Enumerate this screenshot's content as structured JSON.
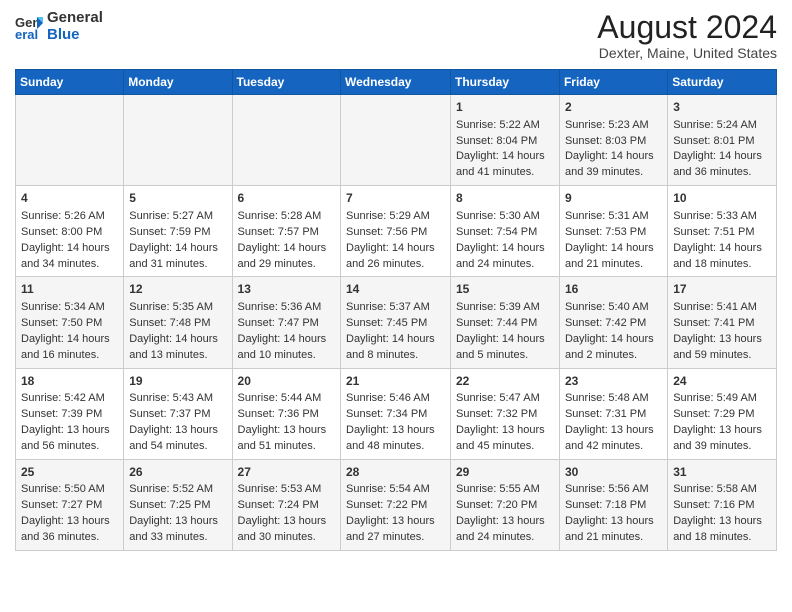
{
  "header": {
    "logo_general": "General",
    "logo_blue": "Blue",
    "month_year": "August 2024",
    "location": "Dexter, Maine, United States"
  },
  "days_of_week": [
    "Sunday",
    "Monday",
    "Tuesday",
    "Wednesday",
    "Thursday",
    "Friday",
    "Saturday"
  ],
  "weeks": [
    [
      {
        "day": "",
        "content": ""
      },
      {
        "day": "",
        "content": ""
      },
      {
        "day": "",
        "content": ""
      },
      {
        "day": "",
        "content": ""
      },
      {
        "day": "1",
        "content": "Sunrise: 5:22 AM\nSunset: 8:04 PM\nDaylight: 14 hours\nand 41 minutes."
      },
      {
        "day": "2",
        "content": "Sunrise: 5:23 AM\nSunset: 8:03 PM\nDaylight: 14 hours\nand 39 minutes."
      },
      {
        "day": "3",
        "content": "Sunrise: 5:24 AM\nSunset: 8:01 PM\nDaylight: 14 hours\nand 36 minutes."
      }
    ],
    [
      {
        "day": "4",
        "content": "Sunrise: 5:26 AM\nSunset: 8:00 PM\nDaylight: 14 hours\nand 34 minutes."
      },
      {
        "day": "5",
        "content": "Sunrise: 5:27 AM\nSunset: 7:59 PM\nDaylight: 14 hours\nand 31 minutes."
      },
      {
        "day": "6",
        "content": "Sunrise: 5:28 AM\nSunset: 7:57 PM\nDaylight: 14 hours\nand 29 minutes."
      },
      {
        "day": "7",
        "content": "Sunrise: 5:29 AM\nSunset: 7:56 PM\nDaylight: 14 hours\nand 26 minutes."
      },
      {
        "day": "8",
        "content": "Sunrise: 5:30 AM\nSunset: 7:54 PM\nDaylight: 14 hours\nand 24 minutes."
      },
      {
        "day": "9",
        "content": "Sunrise: 5:31 AM\nSunset: 7:53 PM\nDaylight: 14 hours\nand 21 minutes."
      },
      {
        "day": "10",
        "content": "Sunrise: 5:33 AM\nSunset: 7:51 PM\nDaylight: 14 hours\nand 18 minutes."
      }
    ],
    [
      {
        "day": "11",
        "content": "Sunrise: 5:34 AM\nSunset: 7:50 PM\nDaylight: 14 hours\nand 16 minutes."
      },
      {
        "day": "12",
        "content": "Sunrise: 5:35 AM\nSunset: 7:48 PM\nDaylight: 14 hours\nand 13 minutes."
      },
      {
        "day": "13",
        "content": "Sunrise: 5:36 AM\nSunset: 7:47 PM\nDaylight: 14 hours\nand 10 minutes."
      },
      {
        "day": "14",
        "content": "Sunrise: 5:37 AM\nSunset: 7:45 PM\nDaylight: 14 hours\nand 8 minutes."
      },
      {
        "day": "15",
        "content": "Sunrise: 5:39 AM\nSunset: 7:44 PM\nDaylight: 14 hours\nand 5 minutes."
      },
      {
        "day": "16",
        "content": "Sunrise: 5:40 AM\nSunset: 7:42 PM\nDaylight: 14 hours\nand 2 minutes."
      },
      {
        "day": "17",
        "content": "Sunrise: 5:41 AM\nSunset: 7:41 PM\nDaylight: 13 hours\nand 59 minutes."
      }
    ],
    [
      {
        "day": "18",
        "content": "Sunrise: 5:42 AM\nSunset: 7:39 PM\nDaylight: 13 hours\nand 56 minutes."
      },
      {
        "day": "19",
        "content": "Sunrise: 5:43 AM\nSunset: 7:37 PM\nDaylight: 13 hours\nand 54 minutes."
      },
      {
        "day": "20",
        "content": "Sunrise: 5:44 AM\nSunset: 7:36 PM\nDaylight: 13 hours\nand 51 minutes."
      },
      {
        "day": "21",
        "content": "Sunrise: 5:46 AM\nSunset: 7:34 PM\nDaylight: 13 hours\nand 48 minutes."
      },
      {
        "day": "22",
        "content": "Sunrise: 5:47 AM\nSunset: 7:32 PM\nDaylight: 13 hours\nand 45 minutes."
      },
      {
        "day": "23",
        "content": "Sunrise: 5:48 AM\nSunset: 7:31 PM\nDaylight: 13 hours\nand 42 minutes."
      },
      {
        "day": "24",
        "content": "Sunrise: 5:49 AM\nSunset: 7:29 PM\nDaylight: 13 hours\nand 39 minutes."
      }
    ],
    [
      {
        "day": "25",
        "content": "Sunrise: 5:50 AM\nSunset: 7:27 PM\nDaylight: 13 hours\nand 36 minutes."
      },
      {
        "day": "26",
        "content": "Sunrise: 5:52 AM\nSunset: 7:25 PM\nDaylight: 13 hours\nand 33 minutes."
      },
      {
        "day": "27",
        "content": "Sunrise: 5:53 AM\nSunset: 7:24 PM\nDaylight: 13 hours\nand 30 minutes."
      },
      {
        "day": "28",
        "content": "Sunrise: 5:54 AM\nSunset: 7:22 PM\nDaylight: 13 hours\nand 27 minutes."
      },
      {
        "day": "29",
        "content": "Sunrise: 5:55 AM\nSunset: 7:20 PM\nDaylight: 13 hours\nand 24 minutes."
      },
      {
        "day": "30",
        "content": "Sunrise: 5:56 AM\nSunset: 7:18 PM\nDaylight: 13 hours\nand 21 minutes."
      },
      {
        "day": "31",
        "content": "Sunrise: 5:58 AM\nSunset: 7:16 PM\nDaylight: 13 hours\nand 18 minutes."
      }
    ]
  ]
}
